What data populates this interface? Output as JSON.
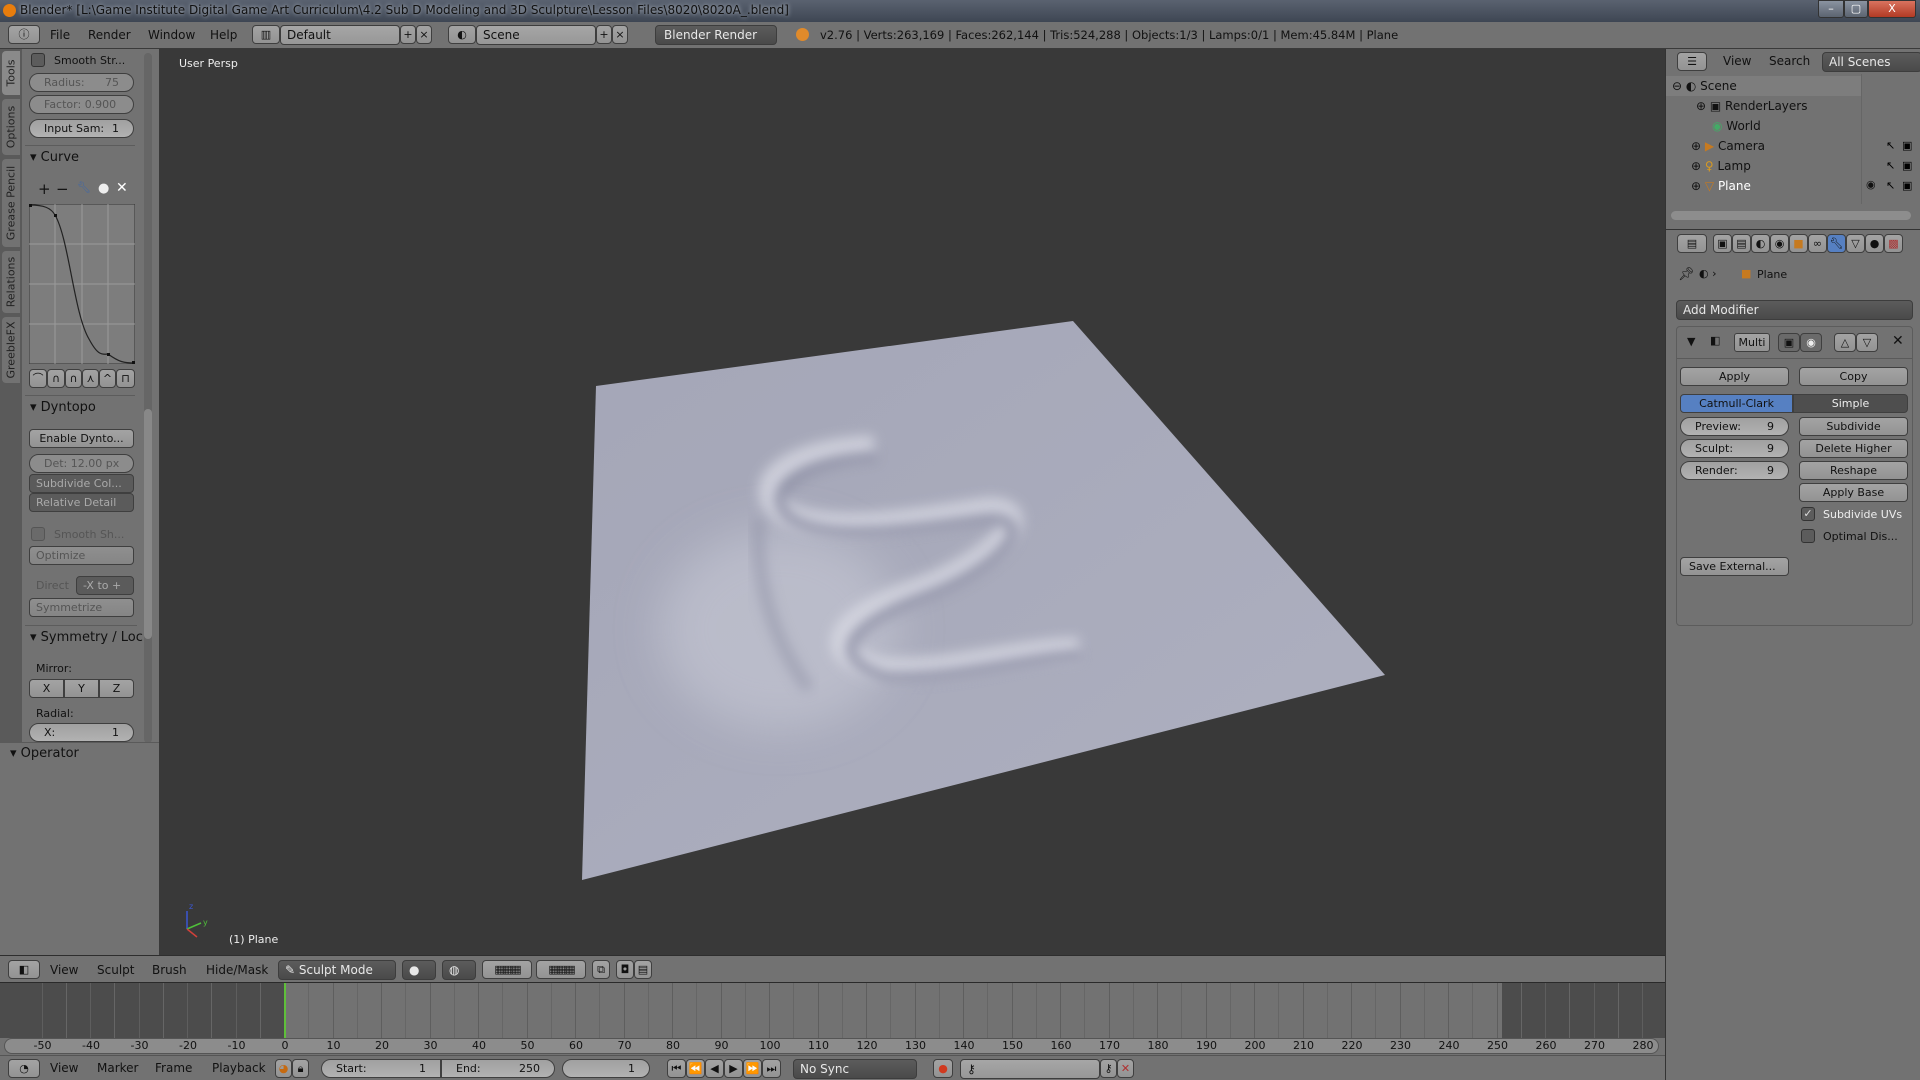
{
  "window": {
    "title": "Blender* [L:\\Game Institute Digital Game Art  Curriculum\\4.2 Sub D Modeling and 3D Sculpture\\Lesson Files\\8020\\8020A_.blend]",
    "minimize": "–",
    "maximize": "▢",
    "close": "X"
  },
  "topbar": {
    "menus": [
      "File",
      "Render",
      "Window",
      "Help"
    ],
    "layout": "Default",
    "scene": "Scene",
    "engine": "Blender Render",
    "stats": "v2.76 | Verts:263,169 | Faces:262,144 | Tris:524,288 | Objects:1/3 | Lamps:0/1 | Mem:45.84M | Plane"
  },
  "lefttabs": [
    "Tools",
    "Options",
    "Grease Pencil",
    "Relations",
    "GreebleFX"
  ],
  "tools": {
    "smooth_stroke": "Smooth Str...",
    "radius_label": "Radius:",
    "radius": "75",
    "factor_label": "Factor:",
    "factor": "0.900",
    "input_label": "Input Sam:",
    "input": "1",
    "curve_header": "Curve",
    "dyntopo_header": "Dyntopo",
    "enable_dyntopo": "Enable Dynto...",
    "detail": "Det: 12.00 px",
    "subdivide_collapse": "Subdivide Col...",
    "relative_detail": "Relative Detail",
    "smooth_shading": "Smooth Sh...",
    "optimize": "Optimize",
    "direction_label": "Direct",
    "direction": "-X to +",
    "symmetrize": "Symmetrize",
    "symmetry_header": "Symmetry / Loc",
    "mirror_label": "Mirror:",
    "mirror": [
      "X",
      "Y",
      "Z"
    ],
    "radial_label": "Radial:",
    "radial_x_label": "X:",
    "radial_x": "1",
    "operator_header": "Operator"
  },
  "viewport": {
    "view_name": "User Persp",
    "object_label": "(1) Plane",
    "plane_color": "#a9abbc"
  },
  "viewport_header": {
    "menus": [
      "View",
      "Sculpt",
      "Brush",
      "Hide/Mask"
    ],
    "mode": "Sculpt Mode"
  },
  "timeline": {
    "ticks": [
      "-50",
      "-40",
      "-30",
      "-20",
      "-10",
      "0",
      "10",
      "20",
      "30",
      "40",
      "50",
      "60",
      "70",
      "80",
      "90",
      "100",
      "110",
      "120",
      "130",
      "140",
      "150",
      "160",
      "170",
      "180",
      "190",
      "200",
      "210",
      "220",
      "230",
      "240",
      "250",
      "260",
      "270",
      "280"
    ],
    "current_frame": 0,
    "frame_color": "#5fbf3a"
  },
  "timeline_header": {
    "menus": [
      "View",
      "Marker",
      "Frame",
      "Playback"
    ],
    "start_label": "Start:",
    "start": "1",
    "end_label": "End:",
    "end": "250",
    "frame": "1",
    "sync": "No Sync"
  },
  "outliner": {
    "menus": [
      "View",
      "Search"
    ],
    "filter": "All Scenes",
    "items": [
      "Scene",
      "RenderLayers",
      "World",
      "Camera",
      "Lamp",
      "Plane"
    ]
  },
  "properties": {
    "breadcrumb": "Plane",
    "add_modifier": "Add Modifier",
    "modifier_name": "Multi",
    "apply": "Apply",
    "copy": "Copy",
    "catmull": "Catmull-Clark",
    "simple": "Simple",
    "preview_label": "Preview:",
    "preview": "9",
    "sculpt_label": "Sculpt:",
    "sculpt": "9",
    "render_label": "Render:",
    "render": "9",
    "subdivide": "Subdivide",
    "delete_higher": "Delete Higher",
    "reshape": "Reshape",
    "apply_base": "Apply Base",
    "subdivide_uvs": "Subdivide UVs",
    "optimal_display": "Optimal Dis...",
    "save_external": "Save External...",
    "subdivide_uvs_checked": true,
    "optimal_display_checked": false,
    "accent": "#5680c2"
  }
}
